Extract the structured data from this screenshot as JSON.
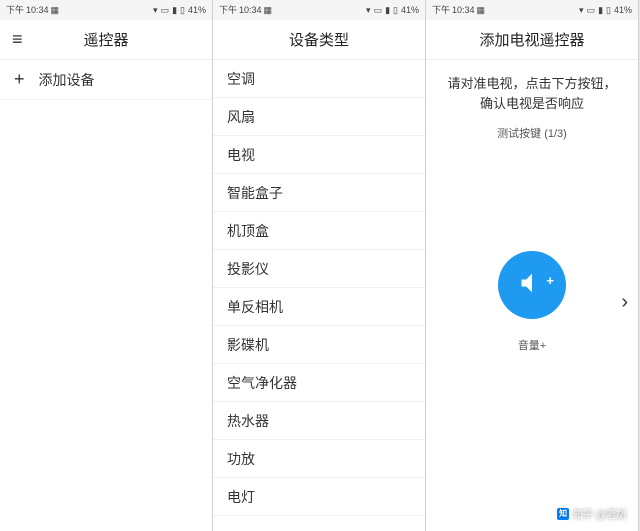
{
  "statusbar": {
    "time_prefix": "下午",
    "time": "10:34",
    "battery": "41%"
  },
  "screen1": {
    "title": "遥控器",
    "add_device": "添加设备"
  },
  "screen2": {
    "title": "设备类型",
    "items": [
      "空调",
      "风扇",
      "电视",
      "智能盒子",
      "机顶盒",
      "投影仪",
      "单反相机",
      "影碟机",
      "空气净化器",
      "热水器",
      "功放",
      "电灯"
    ]
  },
  "screen3": {
    "title": "添加电视遥控器",
    "instruction": "请对准电视，点击下方按钮，确认电视是否响应",
    "test_label": "测试按键 (1/3)",
    "button_label": "音量+"
  },
  "watermark": {
    "logo": "知",
    "text": "知乎 @老胡"
  }
}
